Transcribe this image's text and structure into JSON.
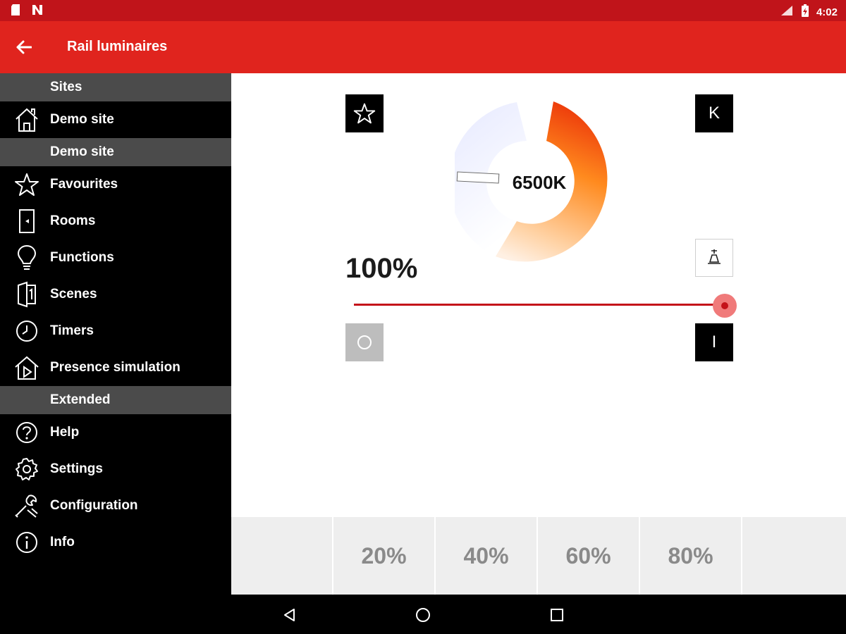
{
  "status_bar": {
    "time": "4:02"
  },
  "header": {
    "title": "Rail luminaires"
  },
  "sidebar": {
    "section_sites": "Sites",
    "site_item": "Demo site",
    "section_demo": "Demo site",
    "items": [
      {
        "label": "Favourites",
        "icon": "star-icon"
      },
      {
        "label": "Rooms",
        "icon": "door-icon"
      },
      {
        "label": "Functions",
        "icon": "lightbulb-icon"
      },
      {
        "label": "Scenes",
        "icon": "scene-icon"
      },
      {
        "label": "Timers",
        "icon": "clock-icon"
      },
      {
        "label": "Presence simulation",
        "icon": "presence-house-icon"
      }
    ],
    "section_extended": "Extended",
    "extended_items": [
      {
        "label": "Help",
        "icon": "help-icon"
      },
      {
        "label": "Settings",
        "icon": "gear-icon"
      },
      {
        "label": "Configuration",
        "icon": "wrench-icon"
      },
      {
        "label": "Info",
        "icon": "info-icon"
      }
    ]
  },
  "control": {
    "color_temperature": "6500K",
    "brightness": "100%",
    "brightness_value": 1.0,
    "kelvin_button": "K",
    "on_button": "I",
    "presets": [
      "",
      "20%",
      "40%",
      "60%",
      "80%",
      ""
    ]
  },
  "colors": {
    "status_bar": "#c0141a",
    "app_bar": "#e0241e",
    "accent": "#c4121a",
    "section_header": "#4b4b4b"
  }
}
